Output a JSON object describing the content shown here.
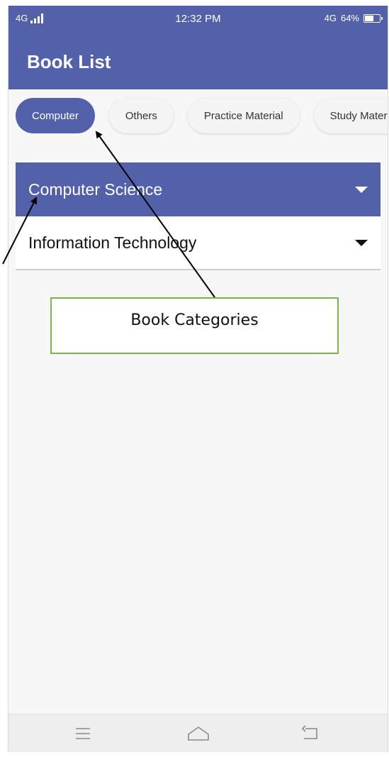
{
  "status_bar": {
    "network_left": "4G",
    "time": "12:32 PM",
    "network_right": "4G",
    "battery_percent": "64%",
    "battery_level": 0.64
  },
  "app_bar": {
    "title": "Book List"
  },
  "chips": [
    {
      "label": "Computer",
      "selected": true
    },
    {
      "label": "Others",
      "selected": false
    },
    {
      "label": "Practice Material",
      "selected": false
    },
    {
      "label": "Study Material",
      "selected": false
    }
  ],
  "panels": [
    {
      "label": "Computer Science",
      "expanded": true
    },
    {
      "label": "Information Technology",
      "expanded": false
    }
  ],
  "annotation": {
    "callout_text": "Book Categories",
    "callout_border_color": "#7ab648"
  },
  "nav_bar": {
    "buttons": [
      "menu-icon",
      "home-icon",
      "back-icon"
    ]
  },
  "theme": {
    "primary": "#5361ab",
    "background": "#f7f7f7"
  }
}
